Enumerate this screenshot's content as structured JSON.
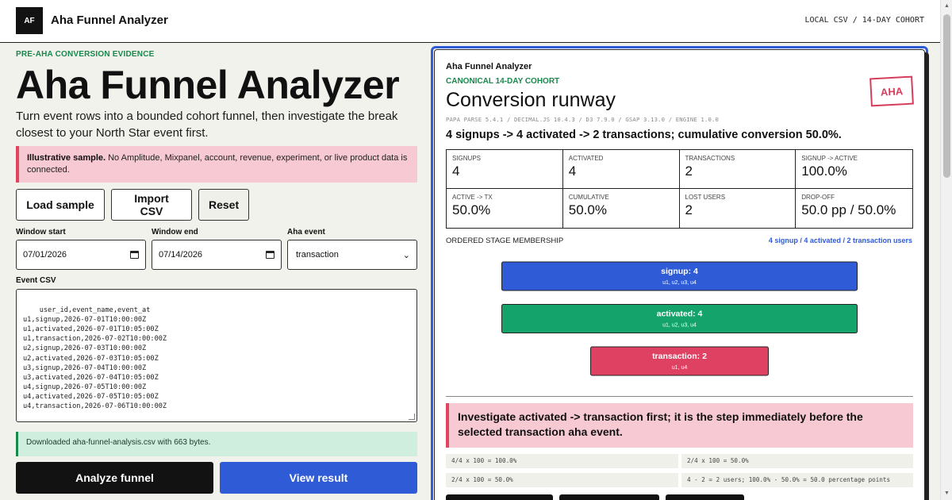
{
  "header": {
    "logo": "AF",
    "app_title": "Aha Funnel Analyzer",
    "source_tag": "LOCAL CSV / 14-DAY COHORT"
  },
  "hero": {
    "eyebrow": "PRE-AHA CONVERSION EVIDENCE",
    "title": "Aha Funnel Analyzer",
    "lede": "Turn event rows into a bounded cohort funnel, then investigate the break closest to your North Star event first."
  },
  "notice": {
    "strong": "Illustrative sample.",
    "text": " No Amplitude, Mixpanel, account, revenue, experiment, or live product data is connected."
  },
  "actions": {
    "load_sample": "Load sample",
    "import_csv": "Import CSV",
    "reset": "Reset"
  },
  "form": {
    "window_start_label": "Window start",
    "window_start_value": "07/01/2026",
    "window_end_label": "Window end",
    "window_end_value": "07/14/2026",
    "aha_event_label": "Aha event",
    "aha_event_value": "transaction",
    "csv_label": "Event CSV",
    "csv_value": "user_id,event_name,event_at\nu1,signup,2026-07-01T10:00:00Z\nu1,activated,2026-07-01T10:05:00Z\nu1,transaction,2026-07-02T10:00:00Z\nu2,signup,2026-07-03T10:00:00Z\nu2,activated,2026-07-03T10:05:00Z\nu3,signup,2026-07-04T10:00:00Z\nu3,activated,2026-07-04T10:05:00Z\nu4,signup,2026-07-05T10:00:00Z\nu4,activated,2026-07-05T10:05:00Z\nu4,transaction,2026-07-06T10:00:00Z"
  },
  "download_note": "Downloaded aha-funnel-analysis.csv with 663 bytes.",
  "buttons": {
    "analyze": "Analyze funnel",
    "view_result": "View result"
  },
  "panel": {
    "title_small": "Aha Funnel Analyzer",
    "eyebrow": "CANONICAL 14-DAY COHORT",
    "title": "Conversion runway",
    "libs": "PAPA PARSE 5.4.1 / DECIMAL.JS 10.4.3 / D3 7.9.0 / GSAP 3.13.0 / ENGINE 1.0.0",
    "stamp": "AHA",
    "summary": "4 signups -> 4 activated -> 2 transactions; cumulative conversion 50.0%.",
    "metrics": [
      {
        "label": "SIGNUPS",
        "value": "4"
      },
      {
        "label": "ACTIVATED",
        "value": "4"
      },
      {
        "label": "TRANSACTIONS",
        "value": "2"
      },
      {
        "label": "SIGNUP -> ACTIVE",
        "value": "100.0%"
      },
      {
        "label": "ACTIVE -> TX",
        "value": "50.0%"
      },
      {
        "label": "CUMULATIVE",
        "value": "50.0%"
      },
      {
        "label": "LOST USERS",
        "value": "2"
      },
      {
        "label": "DROP-OFF",
        "value": "50.0 pp / 50.0%"
      }
    ],
    "stage_header": "ORDERED STAGE MEMBERSHIP",
    "stage_count": "4 signup / 4 activated / 2 transaction users",
    "insight": "Investigate activated -> transaction first; it is the step immediately before the selected transaction aha event.",
    "calcs": [
      "4/4 x 100 = 100.0%",
      "2/4 x 100 = 50.0%",
      "2/4 x 100 = 50.0%",
      "4 - 2 = 2 users; 100.0% - 50.0% = 50.0 percentage points"
    ]
  },
  "chart_data": {
    "type": "bar",
    "orientation": "horizontal-funnel",
    "categories": [
      "signup",
      "activated",
      "transaction"
    ],
    "values": [
      4,
      4,
      2
    ],
    "labels": [
      "signup: 4",
      "activated: 4",
      "transaction: 2"
    ],
    "members": [
      "u1, u2, u3, u4",
      "u1, u2, u3, u4",
      "u1, u4"
    ],
    "colors": [
      "#2f5bd6",
      "#14a36a",
      "#de4162"
    ],
    "xlim": [
      0,
      4
    ]
  }
}
